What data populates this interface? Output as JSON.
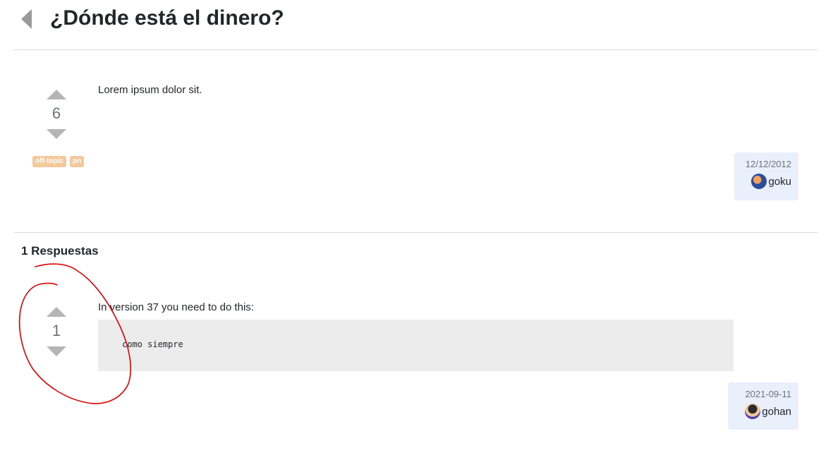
{
  "header": {
    "title": "¿Dónde está el dinero?",
    "back_icon": "chevron-left-icon"
  },
  "question": {
    "votes": "6",
    "body": "Lorem ipsum dolor sit.",
    "tags": [
      "off-topic",
      "pn"
    ],
    "author": {
      "date": "12/12/2012",
      "name": "goku"
    }
  },
  "answers": {
    "heading": "1 Respuestas",
    "items": [
      {
        "votes": "1",
        "text": "In version 37 you need to do this:",
        "code": "como siempre",
        "author": {
          "date": "2021-09-11",
          "name": "gohan"
        }
      }
    ]
  },
  "colors": {
    "tag_bg": "#f3c89a",
    "user_card_bg": "#e9effb",
    "code_bg": "#ececec",
    "vote_arrow": "#b5b5b5",
    "annotation": "#e00000"
  }
}
